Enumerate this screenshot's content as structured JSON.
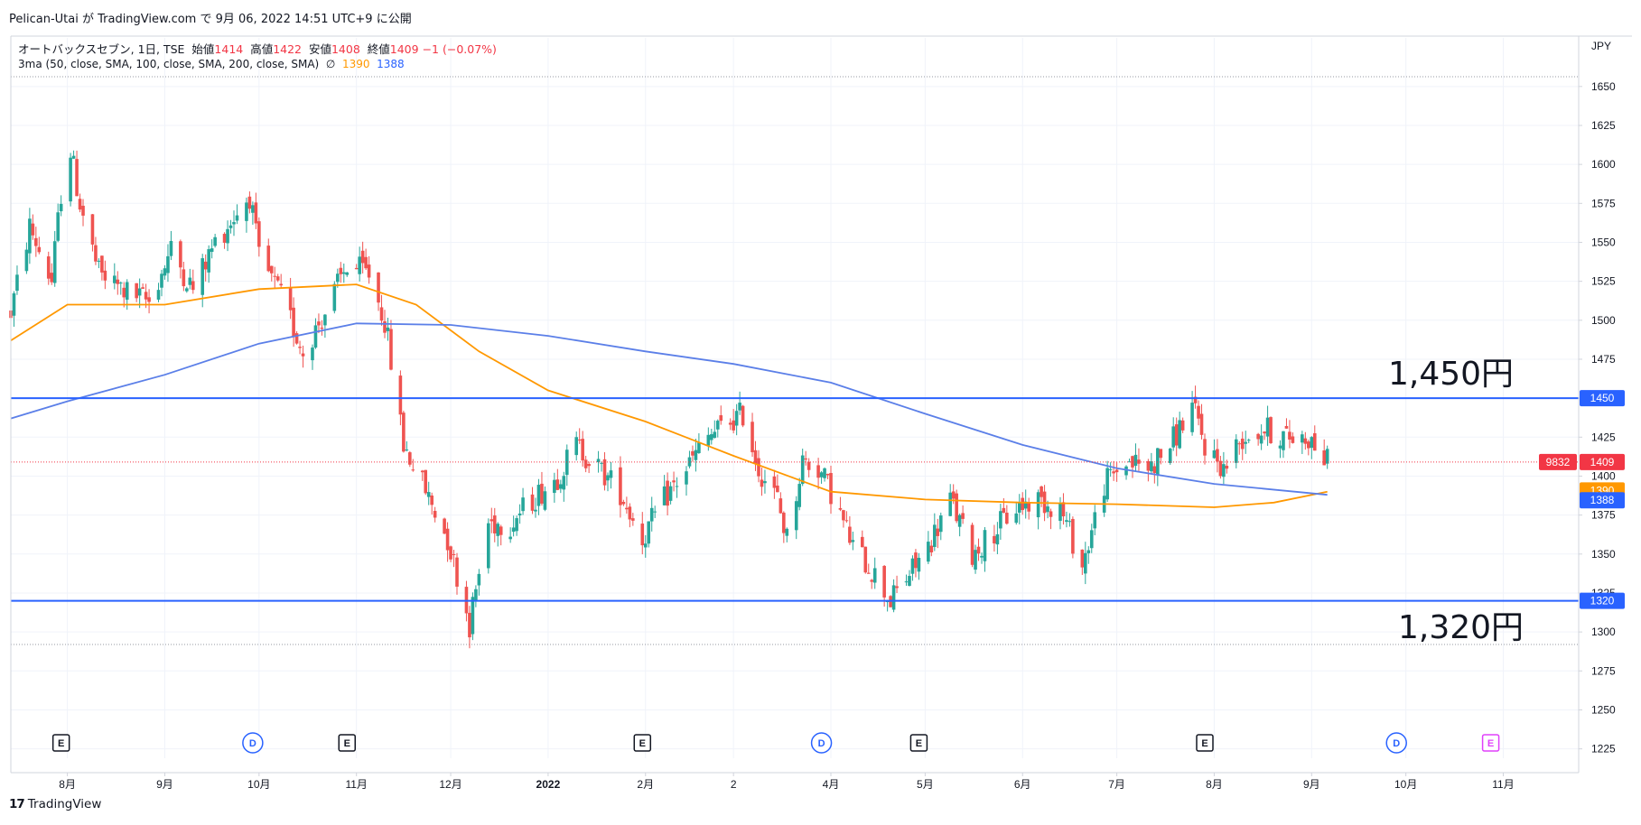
{
  "header": {
    "publisher": "Pelican-Utai",
    "text": "Pelican-Utai が TradingView.com で 9月 06, 2022 14:51 UTC+9 に公開"
  },
  "legend": {
    "symbol": "オートバックスセブン, 1日, TSE",
    "open_label": "始値",
    "open": "1414",
    "high_label": "高値",
    "high": "1422",
    "low_label": "安値",
    "low": "1408",
    "close_label": "終値",
    "close": "1409",
    "change": "−1 (−0.07%)",
    "indicator": "3ma (50, close, SMA, 100, close, SMA, 200, close, SMA)",
    "indicator_symbol": "∅",
    "ma_orange_value": "1390",
    "ma_blue_value": "1388"
  },
  "footer": {
    "logo": "17",
    "brand": "TradingView"
  },
  "annotations": {
    "resistance_label": "1,450円",
    "support_label": "1,320円"
  },
  "chart_data": {
    "type": "candlestick",
    "currency": "JPY",
    "y_ticks": [
      1225,
      1250,
      1275,
      1300,
      1325,
      1350,
      1375,
      1400,
      1425,
      1450,
      1475,
      1500,
      1525,
      1550,
      1575,
      1600,
      1625,
      1650
    ],
    "ylim": [
      1219,
      1658
    ],
    "x_range": [
      "2021-07-14",
      "2022-11-25"
    ],
    "x_ticks": [
      {
        "label": "8月",
        "date": "2021-08-01"
      },
      {
        "label": "9月",
        "date": "2021-09-01"
      },
      {
        "label": "10月",
        "date": "2021-10-01"
      },
      {
        "label": "11月",
        "date": "2021-11-01"
      },
      {
        "label": "12月",
        "date": "2021-12-01"
      },
      {
        "label": "2022",
        "date": "2022-01-01"
      },
      {
        "label": "2月",
        "date": "2022-02-01"
      },
      {
        "label": "2",
        "date": "2022-03-01"
      },
      {
        "label": "4月",
        "date": "2022-04-01"
      },
      {
        "label": "5月",
        "date": "2022-05-01"
      },
      {
        "label": "6月",
        "date": "2022-06-01"
      },
      {
        "label": "7月",
        "date": "2022-07-01"
      },
      {
        "label": "8月",
        "date": "2022-08-01"
      },
      {
        "label": "9月",
        "date": "2022-09-01"
      },
      {
        "label": "10月",
        "date": "2022-10-01"
      },
      {
        "label": "11月",
        "date": "2022-11-01"
      }
    ],
    "price_anchors": [
      [
        "2021-07-14",
        1505
      ],
      [
        "2021-07-20",
        1560
      ],
      [
        "2021-07-27",
        1525
      ],
      [
        "2021-08-01",
        1620
      ],
      [
        "2021-08-05",
        1575
      ],
      [
        "2021-08-11",
        1530
      ],
      [
        "2021-08-20",
        1518
      ],
      [
        "2021-08-27",
        1512
      ],
      [
        "2021-09-03",
        1545
      ],
      [
        "2021-09-10",
        1520
      ],
      [
        "2021-09-17",
        1550
      ],
      [
        "2021-09-28",
        1580
      ],
      [
        "2021-10-01",
        1540
      ],
      [
        "2021-10-08",
        1515
      ],
      [
        "2021-10-15",
        1480
      ],
      [
        "2021-10-22",
        1505
      ],
      [
        "2021-10-29",
        1535
      ],
      [
        "2021-11-05",
        1530
      ],
      [
        "2021-11-10",
        1500
      ],
      [
        "2021-11-16",
        1420
      ],
      [
        "2021-11-22",
        1395
      ],
      [
        "2021-11-30",
        1360
      ],
      [
        "2021-12-07",
        1305
      ],
      [
        "2021-12-13",
        1370
      ],
      [
        "2021-12-20",
        1370
      ],
      [
        "2021-12-27",
        1385
      ],
      [
        "2022-01-04",
        1400
      ],
      [
        "2022-01-10",
        1420
      ],
      [
        "2022-01-17",
        1405
      ],
      [
        "2022-01-24",
        1390
      ],
      [
        "2022-01-31",
        1360
      ],
      [
        "2022-02-07",
        1385
      ],
      [
        "2022-02-14",
        1405
      ],
      [
        "2022-02-21",
        1425
      ],
      [
        "2022-02-28",
        1435
      ],
      [
        "2022-03-04",
        1440
      ],
      [
        "2022-03-09",
        1405
      ],
      [
        "2022-03-15",
        1385
      ],
      [
        "2022-03-18",
        1360
      ],
      [
        "2022-03-23",
        1410
      ],
      [
        "2022-03-28",
        1405
      ],
      [
        "2022-04-01",
        1390
      ],
      [
        "2022-04-08",
        1355
      ],
      [
        "2022-04-14",
        1340
      ],
      [
        "2022-04-20",
        1320
      ],
      [
        "2022-04-27",
        1340
      ],
      [
        "2022-05-02",
        1355
      ],
      [
        "2022-05-09",
        1385
      ],
      [
        "2022-05-16",
        1350
      ],
      [
        "2022-05-23",
        1365
      ],
      [
        "2022-05-30",
        1380
      ],
      [
        "2022-06-06",
        1385
      ],
      [
        "2022-06-13",
        1380
      ],
      [
        "2022-06-20",
        1342
      ],
      [
        "2022-06-27",
        1395
      ],
      [
        "2022-07-04",
        1410
      ],
      [
        "2022-07-11",
        1405
      ],
      [
        "2022-07-18",
        1420
      ],
      [
        "2022-07-25",
        1445
      ],
      [
        "2022-07-29",
        1420
      ],
      [
        "2022-08-04",
        1405
      ],
      [
        "2022-08-10",
        1425
      ],
      [
        "2022-08-17",
        1430
      ],
      [
        "2022-08-24",
        1425
      ],
      [
        "2022-08-31",
        1425
      ],
      [
        "2022-09-06",
        1409
      ]
    ],
    "series": [
      {
        "name": "50",
        "color": "#ff9800",
        "anchors": [
          [
            "2021-07-14",
            1487
          ],
          [
            "2021-08-01",
            1510
          ],
          [
            "2021-09-01",
            1510
          ],
          [
            "2021-10-01",
            1520
          ],
          [
            "2021-11-01",
            1523
          ],
          [
            "2021-11-20",
            1510
          ],
          [
            "2021-12-10",
            1480
          ],
          [
            "2022-01-01",
            1455
          ],
          [
            "2022-02-01",
            1435
          ],
          [
            "2022-03-01",
            1413
          ],
          [
            "2022-04-01",
            1390
          ],
          [
            "2022-05-01",
            1385
          ],
          [
            "2022-06-01",
            1383
          ],
          [
            "2022-07-01",
            1382
          ],
          [
            "2022-08-01",
            1380
          ],
          [
            "2022-08-20",
            1383
          ],
          [
            "2022-09-06",
            1390
          ]
        ]
      },
      {
        "name": "200",
        "color": "#5b7fe8",
        "anchors": [
          [
            "2021-07-14",
            1437
          ],
          [
            "2021-08-01",
            1448
          ],
          [
            "2021-09-01",
            1465
          ],
          [
            "2021-10-01",
            1485
          ],
          [
            "2021-11-01",
            1498
          ],
          [
            "2021-12-01",
            1497
          ],
          [
            "2022-01-01",
            1490
          ],
          [
            "2022-02-01",
            1480
          ],
          [
            "2022-03-01",
            1472
          ],
          [
            "2022-04-01",
            1460
          ],
          [
            "2022-05-01",
            1440
          ],
          [
            "2022-06-01",
            1420
          ],
          [
            "2022-07-01",
            1405
          ],
          [
            "2022-08-01",
            1395
          ],
          [
            "2022-09-06",
            1388
          ]
        ]
      }
    ],
    "horizontal_lines": [
      {
        "value": 1450,
        "label": "1450",
        "color": "#2962ff"
      },
      {
        "value": 1320,
        "label": "1320",
        "color": "#2962ff"
      }
    ],
    "last_price": {
      "value": 1409,
      "label": "1409",
      "volume_label": "9832"
    },
    "ma_price_labels": [
      {
        "value": 1390,
        "label": "1390",
        "color": "#ff9800"
      },
      {
        "value": 1388,
        "label": "1388",
        "color": "#2962ff"
      }
    ],
    "events": [
      {
        "type": "E",
        "date": "2021-07-30",
        "color": "#131722"
      },
      {
        "type": "D",
        "date": "2021-09-29",
        "color": "#2962ff"
      },
      {
        "type": "E",
        "date": "2021-10-29",
        "color": "#131722"
      },
      {
        "type": "E",
        "date": "2022-01-31",
        "color": "#131722"
      },
      {
        "type": "D",
        "date": "2022-03-29",
        "color": "#2962ff"
      },
      {
        "type": "E",
        "date": "2022-04-29",
        "color": "#131722"
      },
      {
        "type": "E",
        "date": "2022-07-29",
        "color": "#131722"
      },
      {
        "type": "D",
        "date": "2022-09-28",
        "color": "#2962ff"
      },
      {
        "type": "E",
        "date": "2022-10-28",
        "color": "#e040fb"
      }
    ],
    "colors": {
      "up": "#26a69a",
      "down": "#ef5350",
      "axis_bg": "#ffffff"
    }
  }
}
